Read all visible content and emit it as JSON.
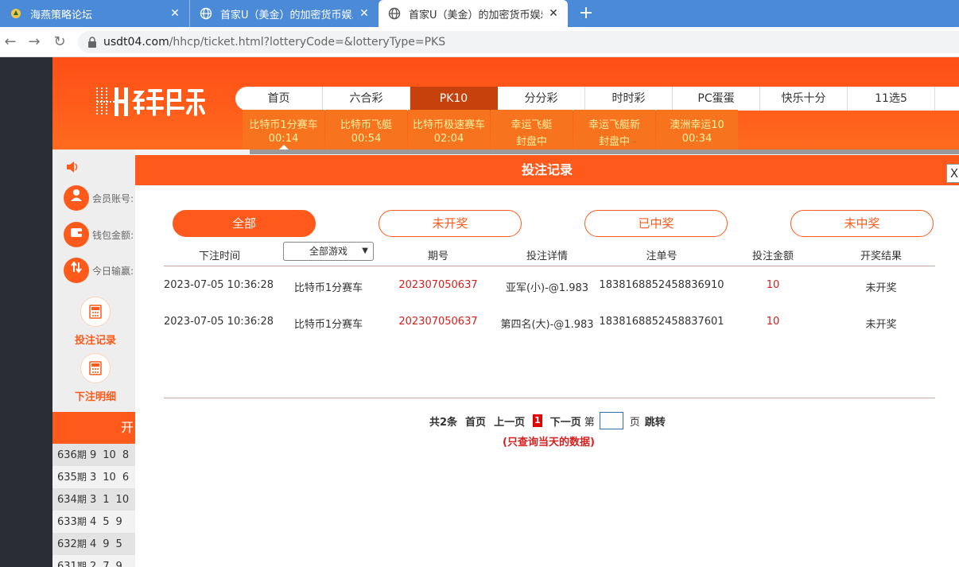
{
  "browser": {
    "tabs": [
      {
        "title": "海燕策略论坛",
        "close": "✕"
      },
      {
        "title": "首家U（美金）的加密货币娱乐城",
        "close": "✕"
      },
      {
        "title": "首家U（美金）的加密货币娱乐城",
        "close": "✕"
      }
    ],
    "new_tab": "+",
    "url_host": "usdt04.com",
    "url_path": "/hhcp/ticket.html?lotteryCode=&lotteryType=PKS"
  },
  "site": {
    "nav": [
      "首页",
      "六合彩",
      "PK10",
      "分分彩",
      "时时彩",
      "PC蛋蛋",
      "快乐十分",
      "11选5"
    ],
    "active_nav": "PK10",
    "subnav": [
      {
        "name": "比特币1分赛车",
        "time": "00:14"
      },
      {
        "name": "比特币飞艇",
        "time": "00:54"
      },
      {
        "name": "比特币极速赛车",
        "time": "02:04"
      },
      {
        "name": "幸运飞艇",
        "time": "封盘中"
      },
      {
        "name": "幸运飞艇新",
        "time": "封盘中"
      },
      {
        "name": "澳洲幸运10",
        "time": "00:34"
      }
    ]
  },
  "sidebar": {
    "account_label": "会员账号:",
    "wallet_label": "钱包金额:",
    "today_label": "今日输赢:",
    "tools": [
      "投注记录",
      "下注明细"
    ],
    "draw_head": "开",
    "draws": [
      {
        "issue": "636",
        "nums": [
          "9",
          "10",
          "8"
        ]
      },
      {
        "issue": "635",
        "nums": [
          "3",
          "10",
          "6"
        ]
      },
      {
        "issue": "634",
        "nums": [
          "3",
          "1",
          "10"
        ]
      },
      {
        "issue": "633",
        "nums": [
          "4",
          "5",
          "9"
        ]
      },
      {
        "issue": "632",
        "nums": [
          "4",
          "9",
          "5"
        ]
      },
      {
        "issue": "631",
        "nums": [
          "2",
          "7",
          "9"
        ]
      }
    ],
    "issue_unit": "期"
  },
  "modal": {
    "title": "投注记录",
    "close": "X",
    "filters": [
      "全部",
      "未开奖",
      "已中奖",
      "未中奖"
    ],
    "headers": {
      "time": "下注时间",
      "game_select": "全部游戏",
      "issue": "期号",
      "detail": "投注详情",
      "order": "注单号",
      "amount": "投注金额",
      "result": "开奖结果"
    },
    "rows": [
      {
        "time": "2023-07-05 10:36:28",
        "game": "比特币1分赛车",
        "issue": "202307050637",
        "detail": "亚军(小)-@1.983",
        "order": "1838168852458836910",
        "amount": "10",
        "result": "未开奖"
      },
      {
        "time": "2023-07-05 10:36:28",
        "game": "比特币1分赛车",
        "issue": "202307050637",
        "detail": "第四名(大)-@1.983",
        "order": "1838168852458837601",
        "amount": "10",
        "result": "未开奖"
      }
    ],
    "pager": {
      "total": "共2条",
      "first": "首页",
      "prev": "上一页",
      "current": "1",
      "next": "下一页",
      "page_prefix": "第",
      "page_suffix": "页",
      "jump": "跳转"
    },
    "note": "(只查询当天的数据)"
  },
  "colors": {
    "brand": "#ff5a1b",
    "active_nav": "#c7410c",
    "red_text": "#d6201e",
    "tabbar": "#4b8ad6"
  }
}
